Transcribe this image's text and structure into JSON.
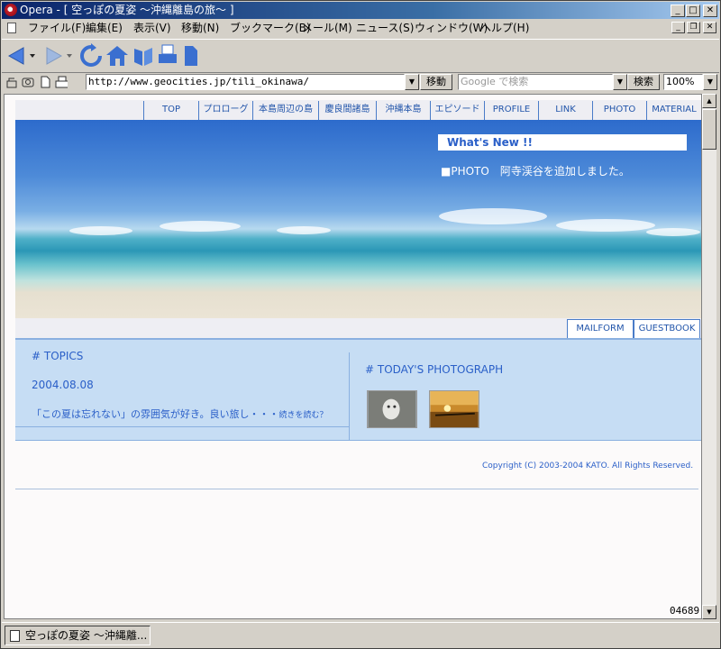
{
  "window": {
    "title": "Opera - [ 空っぽの夏姿 ～沖縄離島の旅～ ]",
    "controls": {
      "minimize": "_",
      "maximize": "□",
      "close": "✕"
    }
  },
  "menu": {
    "items": [
      "ファイル(F)",
      "編集(E)",
      "表示(V)",
      "移動(N)",
      "ブックマーク(B)",
      "メール(M)",
      "ニュース(S)",
      "ウィンドウ(W)",
      "ヘルプ(H)"
    ],
    "mdi": {
      "minimize": "_",
      "restore": "❐",
      "close": "✕"
    }
  },
  "toolbar": {
    "icons": [
      "back-icon",
      "forward-icon",
      "reload-icon",
      "home-icon",
      "hotlist-icon",
      "print-icon",
      "document-icon"
    ]
  },
  "address_bar": {
    "url": "http://www.geocities.jp/tili_okinawa/",
    "go_label": "移動",
    "search_placeholder": "Google で検索",
    "search_label": "検索",
    "zoom": "100%"
  },
  "page": {
    "nav": [
      "TOP",
      "プロローグ",
      "本島周辺の島",
      "慶良間諸島",
      "沖縄本島",
      "エピソード",
      "PROFILE",
      "LINK",
      "PHOTO",
      "MATERIAL"
    ],
    "whats_new": {
      "title": "What's New !!",
      "item_category": "■PHOTO",
      "item_text": "阿寺渓谷を追加しました。"
    },
    "subnav": [
      "MAILFORM",
      "GUESTBOOK"
    ],
    "topics": {
      "heading": "#  TOPICS",
      "date": "2004.08.08",
      "text": "「この夏は忘れない」の雰囲気が好き。良い旅し・・・",
      "more": "続きを読む？"
    },
    "todays_photo": {
      "heading": "#  TODAY'S PHOTOGRAPH",
      "thumbnails": [
        "photo-thumb-dog",
        "photo-thumb-sunset"
      ]
    },
    "copyright": "Copyright (C) 2003-2004 KATO. All Rights Reserved.",
    "counter": "04689"
  },
  "taskbar": {
    "tab_title": "空っぽの夏姿 ～沖縄離..."
  }
}
